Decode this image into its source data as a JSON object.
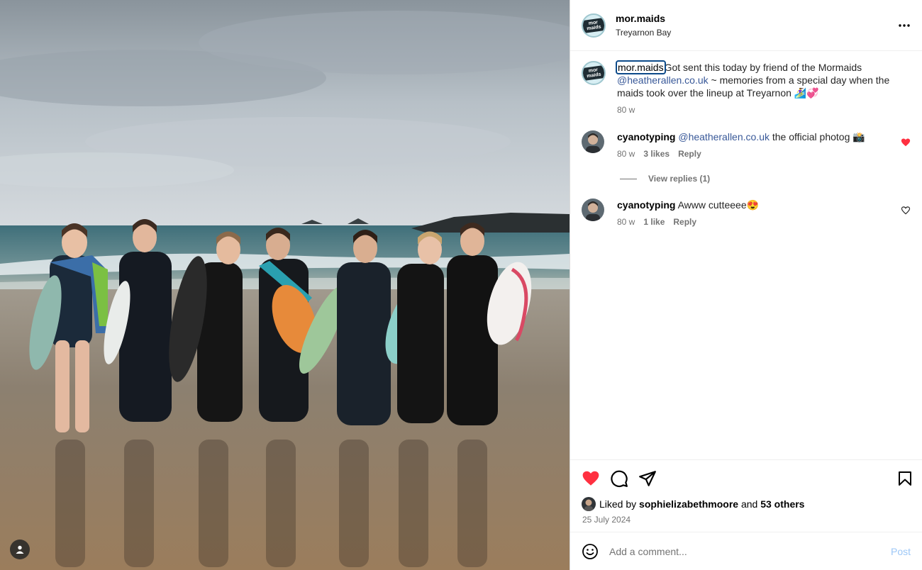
{
  "header": {
    "username": "mor.maids",
    "location": "Treyarnon Bay",
    "avatar_text": "mor maids",
    "more_glyph": "•••"
  },
  "caption": {
    "username": "mor.maids",
    "text_1": "Got sent this today by friend of the Mormaids",
    "mention": "@heatherallen.co.uk",
    "text_2": " ~ memories from a special day when the maids took over the lineup at Treyarnon 🏄‍♀️💞",
    "time": "80 w"
  },
  "comments": [
    {
      "username": "cyanotyping",
      "mention": "@heatherallen.co.uk",
      "text": " the official photog 📸",
      "time": "80 w",
      "likes": "3 likes",
      "reply": "Reply",
      "liked": true
    },
    {
      "username": "cyanotyping",
      "mention": "",
      "text": "Awww cutteeee😍",
      "time": "80 w",
      "likes": "1 like",
      "reply": "Reply",
      "liked": false
    }
  ],
  "view_replies": "View replies (1)",
  "likes": {
    "prefix": "Liked by",
    "user": "sophielizabethmoore",
    "and": "and",
    "others": "53 others"
  },
  "date": "25 July 2024",
  "add_comment": {
    "placeholder": "Add a comment...",
    "post_label": "Post"
  },
  "colors": {
    "heart": "#ff3040",
    "link": "#385898",
    "post_button": "#9cc7f7"
  },
  "icons": [
    "heart-icon",
    "comment-icon",
    "share-icon",
    "bookmark-icon",
    "emoji-icon",
    "more-icon",
    "user-tag-icon"
  ]
}
